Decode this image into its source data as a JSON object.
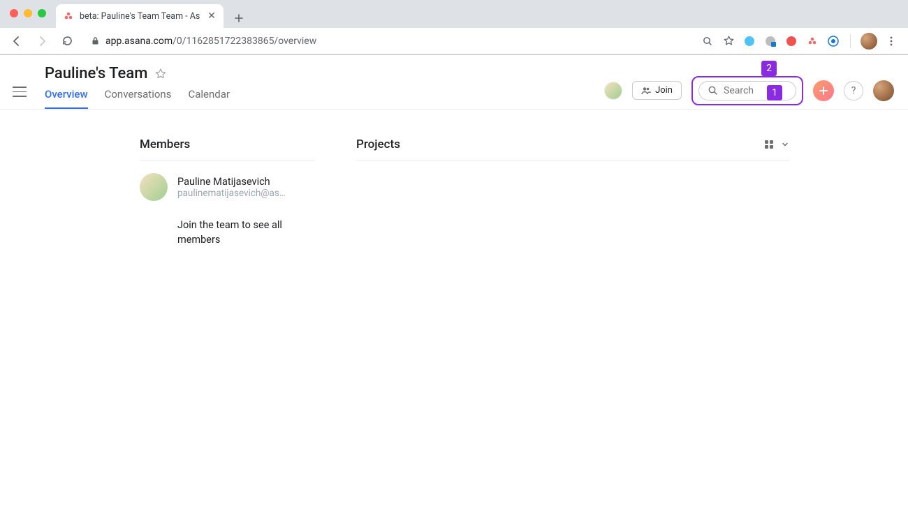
{
  "browser": {
    "tab_title": "beta: Pauline's Team Team - As",
    "url_host": "app.asana.com",
    "url_path": "/0/1162851722383865/overview"
  },
  "header": {
    "title": "Pauline's Team",
    "tabs": {
      "overview": "Overview",
      "conversations": "Conversations",
      "calendar": "Calendar"
    },
    "join_label": "Join",
    "search_placeholder": "Search",
    "help_label": "?"
  },
  "callouts": {
    "one": "1",
    "two": "2"
  },
  "sections": {
    "members_title": "Members",
    "projects_title": "Projects"
  },
  "members": [
    {
      "name": "Pauline Matijasevich",
      "email": "paulinematijasevich@as…"
    }
  ],
  "members_join_note": "Join the team to see all members"
}
